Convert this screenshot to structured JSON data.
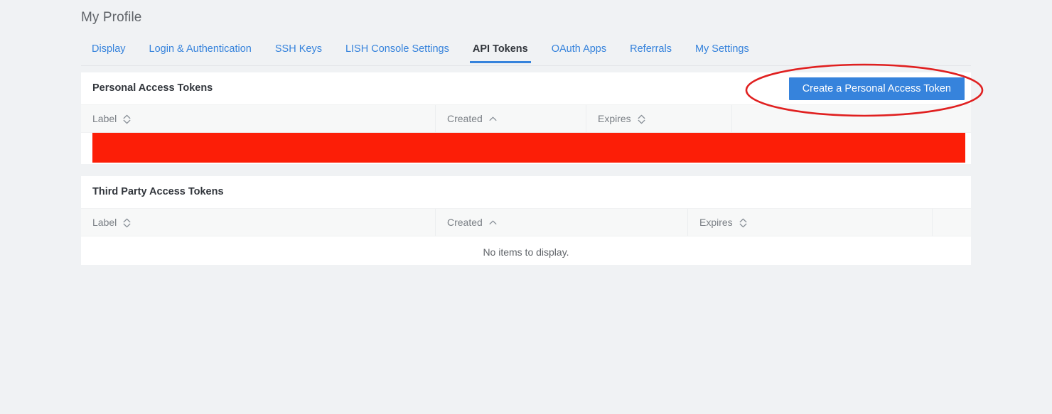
{
  "page": {
    "title": "My Profile",
    "accent_color": "#3683dc",
    "background_color": "#f0f2f4",
    "annotation_color": "#e02020",
    "redaction_color": "#fc1e07"
  },
  "tabs": [
    {
      "label": "Display",
      "active": false
    },
    {
      "label": "Login & Authentication",
      "active": false
    },
    {
      "label": "SSH Keys",
      "active": false
    },
    {
      "label": "LISH Console Settings",
      "active": false
    },
    {
      "label": "API Tokens",
      "active": true
    },
    {
      "label": "OAuth Apps",
      "active": false
    },
    {
      "label": "Referrals",
      "active": false
    },
    {
      "label": "My Settings",
      "active": false
    }
  ],
  "personal_tokens": {
    "title": "Personal Access Tokens",
    "create_button": "Create a Personal Access Token",
    "columns": [
      {
        "label": "Label",
        "sort": "none"
      },
      {
        "label": "Created",
        "sort": "asc"
      },
      {
        "label": "Expires",
        "sort": "none"
      },
      {
        "label": "",
        "sort": "none"
      }
    ],
    "rows": [
      {
        "redacted": true
      }
    ]
  },
  "third_party_tokens": {
    "title": "Third Party Access Tokens",
    "columns": [
      {
        "label": "Label",
        "sort": "none"
      },
      {
        "label": "Created",
        "sort": "asc"
      },
      {
        "label": "Expires",
        "sort": "none"
      },
      {
        "label": "",
        "sort": "none"
      }
    ],
    "empty_message": "No items to display."
  },
  "annotation": {
    "shape": "ellipse",
    "target": "create-personal-access-token-button"
  }
}
